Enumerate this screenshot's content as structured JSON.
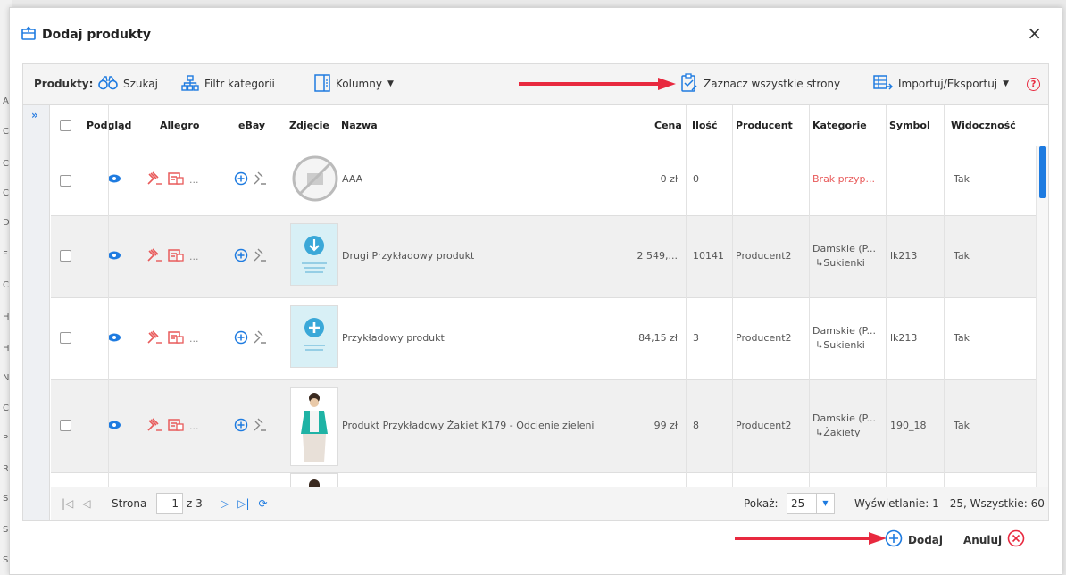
{
  "background_letters": [
    "A",
    "C",
    "C",
    "C",
    "D",
    "F",
    "C",
    "H",
    "H",
    "N",
    "C",
    "P",
    "R",
    "S",
    "S",
    "S"
  ],
  "dialog": {
    "title": "Dodaj produkty",
    "close_label": "×"
  },
  "toolbar": {
    "products_label": "Produkty:",
    "search_label": "Szukaj",
    "category_filter_label": "Filtr kategorii",
    "columns_label": "Kolumny",
    "select_all_pages_label": "Zaznacz wszystkie strony",
    "import_export_label": "Importuj/Eksportuj",
    "help_label": "?"
  },
  "grid": {
    "expand_label": "»",
    "columns": [
      "Podgląd",
      "Allegro",
      "eBay",
      "Zdjęcie",
      "Nazwa",
      "Cena",
      "Ilość",
      "Producent",
      "Kategorie",
      "Symbol",
      "Widoczność"
    ],
    "rows": [
      {
        "allegro_more": "...",
        "name": "AAA",
        "price": "0 zł",
        "qty": "0",
        "producer": "",
        "category_main": "Brak przyp...",
        "category_sub": "",
        "symbol": "",
        "visibility": "Tak",
        "image": "no-image"
      },
      {
        "allegro_more": "...",
        "name": "Drugi Przykładowy produkt",
        "price": "2 549,...",
        "qty": "10141",
        "producer": "Producent2",
        "category_main": "Damskie (P...",
        "category_sub": "↳Sukienki",
        "symbol": "lk213",
        "visibility": "Tak",
        "image": "download-card"
      },
      {
        "allegro_more": "...",
        "name": "Przykładowy produkt",
        "price": "84,15 zł",
        "qty": "3",
        "producer": "Producent2",
        "category_main": "Damskie (P...",
        "category_sub": "↳Sukienki",
        "symbol": "lk213",
        "visibility": "Tak",
        "image": "plus-card"
      },
      {
        "allegro_more": "...",
        "name": "Produkt Przykładowy Żakiet K179 - Odcienie zieleni",
        "price": "99 zł",
        "qty": "8",
        "producer": "Producent2",
        "category_main": "Damskie (P...",
        "category_sub": "↳Żakiety",
        "symbol": "190_18",
        "visibility": "Tak",
        "image": "model-photo"
      }
    ]
  },
  "pager": {
    "page_label": "Strona",
    "current_page": "1",
    "of_label": "z 3",
    "show_label": "Pokaż:",
    "page_size": "25",
    "summary": "Wyświetlanie: 1 - 25, Wszystkie: 60"
  },
  "footer": {
    "add_label": "Dodaj",
    "cancel_label": "Anuluj"
  },
  "colors": {
    "accent_blue": "#1e7be0",
    "annotation_red": "#e8293f",
    "allegro_red": "#e85a5a"
  }
}
